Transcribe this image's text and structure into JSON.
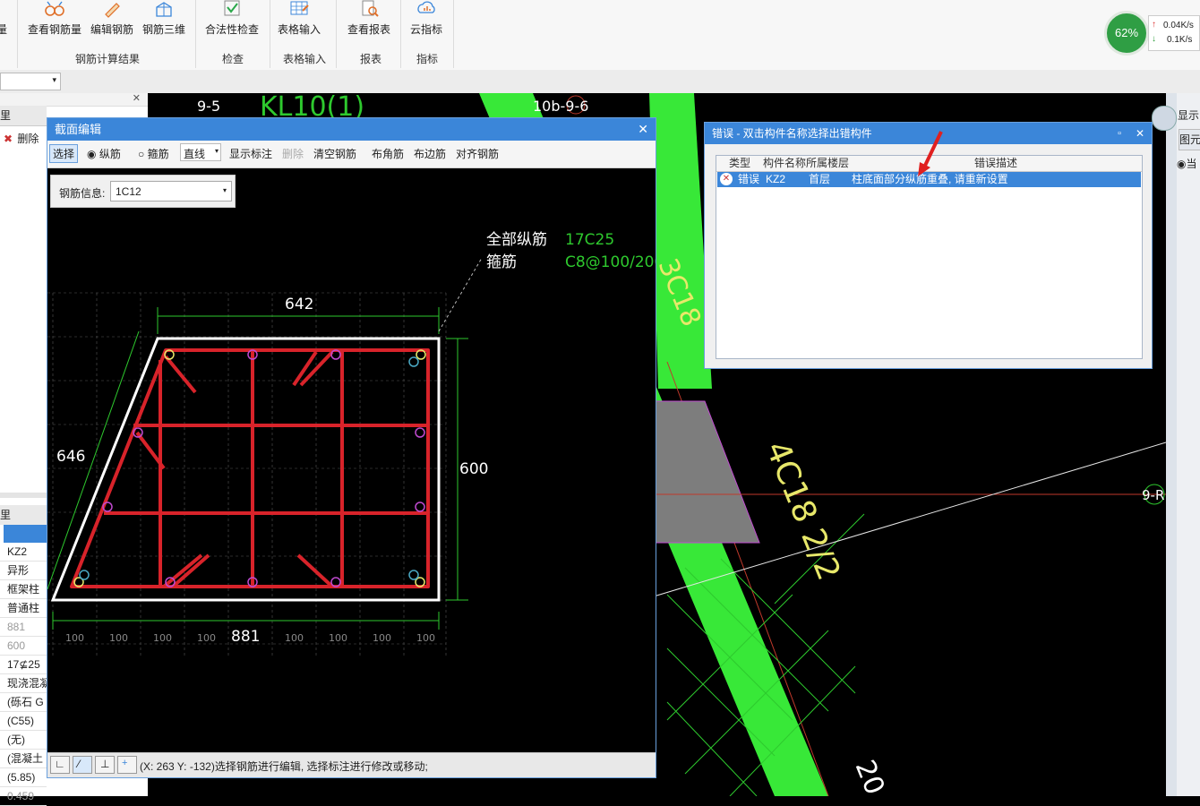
{
  "ribbon": {
    "buttons": [
      {
        "label": "量"
      },
      {
        "label": "查看钢筋量"
      },
      {
        "label": "编辑钢筋"
      },
      {
        "label": "钢筋三维"
      },
      {
        "label": "合法性检查"
      },
      {
        "label": "表格输入"
      },
      {
        "label": "查看报表"
      },
      {
        "label": "云指标"
      }
    ],
    "groups": [
      "钢筋计算结果",
      "检查",
      "表格输入",
      "报表",
      "指标"
    ]
  },
  "network": {
    "percent": "62%",
    "up": "0.04K/s",
    "down": "0.1K/s"
  },
  "left_panel": {
    "delete_label": "删除",
    "tab_label": "里",
    "tab_label2": "里",
    "properties": [
      "KZ2",
      "异形",
      "框架柱",
      "普通柱",
      "881",
      "600",
      "17⊈25",
      "现浇混凝",
      "(砾石 G",
      "(C55)",
      "(无)",
      "(混凝土",
      "(5.85)",
      "0.459"
    ]
  },
  "canvas_labels": {
    "axis_a": "9-5",
    "axis_b": "10b-9-6",
    "axis_c": "9-R",
    "ann1": "3C18",
    "ann2": "4C18 2/2",
    "ann3": "KL10(1)",
    "ann4": "20"
  },
  "section_dialog": {
    "title": "截面编辑",
    "toolbar": {
      "select": "选择",
      "longitudinal": "纵筋",
      "stirrup": "箍筋",
      "line_type": "直线",
      "show_dim": "显示标注",
      "delete": "删除",
      "clear": "清空钢筋",
      "corner": "布角筋",
      "edge": "布边筋",
      "align": "对齐钢筋"
    },
    "rebar_info_label": "钢筋信息:",
    "rebar_info_value": "1C12",
    "drawing": {
      "all_long_label": "全部纵筋",
      "all_long_value": "17C25",
      "stirrup_label": "箍筋",
      "stirrup_value": "C8@100/200",
      "dim_top": "642",
      "dim_left": "646",
      "dim_right": "600",
      "dim_bottom": "881",
      "grid_labels": [
        "100",
        "100",
        "100",
        "100",
        "100",
        "100",
        "100",
        "100"
      ]
    },
    "status_text": "(X: 263 Y: -132)选择钢筋进行编辑, 选择标注进行修改或移动;"
  },
  "error_dialog": {
    "title": "错误 - 双击构件名称选择出错构件",
    "columns": [
      "类型",
      "构件名称",
      "所属楼层",
      "错误描述"
    ],
    "rows": [
      {
        "type": "错误",
        "name": "KZ2",
        "floor": "首层",
        "desc": "柱底面部分纵筋重叠, 请重新设置"
      }
    ]
  },
  "right_panel": {
    "label": "显示",
    "sub": "图元",
    "radio": "当"
  },
  "colors": {
    "accent": "#3b86d9",
    "rebar": "#d8232a",
    "beam": "#38e838",
    "dim": "#2ec92e"
  }
}
